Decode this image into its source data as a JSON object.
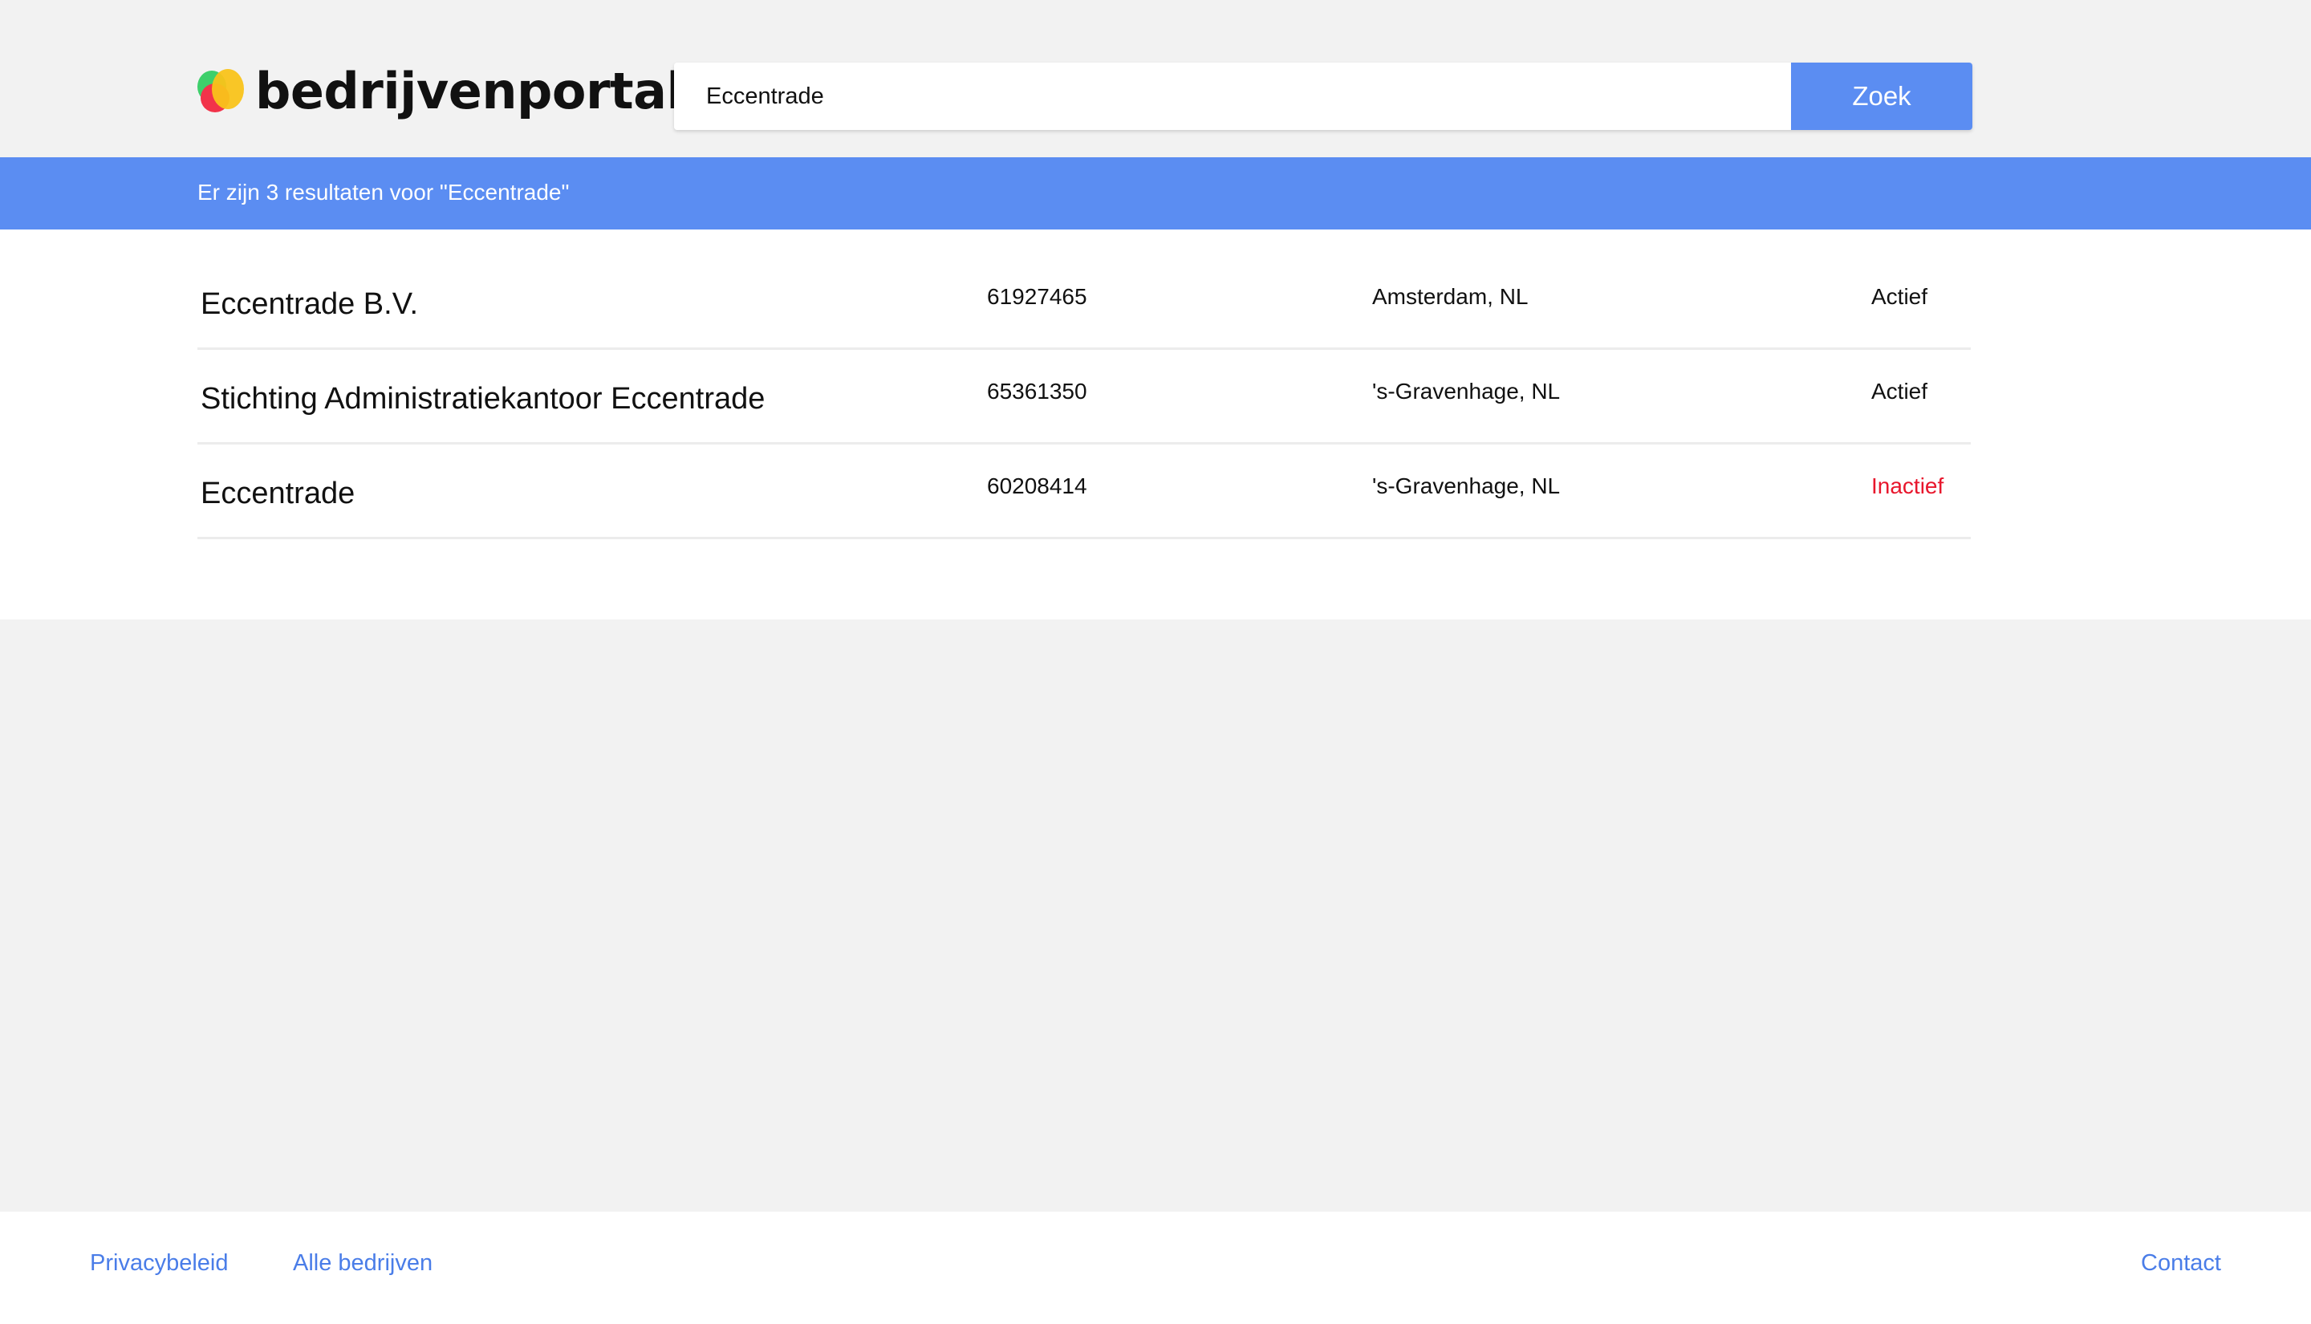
{
  "brand": {
    "name": "bedrijvenportal",
    "logo_icon": "colorful-blob-logo-icon",
    "colors": {
      "green": "#3ecf6b",
      "red": "#f2334a",
      "yellow": "#f9c31a"
    }
  },
  "search": {
    "value": "Eccentrade",
    "button_label": "Zoek"
  },
  "banner": {
    "text": "Er zijn 3 resultaten voor \"Eccentrade\""
  },
  "results": [
    {
      "name": "Eccentrade B.V.",
      "kvk": "61927465",
      "location": "Amsterdam, NL",
      "status": "Actief"
    },
    {
      "name": "Stichting Administratiekantoor Eccentrade",
      "kvk": "65361350",
      "location": "'s-Gravenhage, NL",
      "status": "Actief"
    },
    {
      "name": "Eccentrade",
      "kvk": "60208414",
      "location": "'s-Gravenhage, NL",
      "status": "Inactief"
    }
  ],
  "footer": {
    "privacy": "Privacybeleid",
    "all_companies": "Alle bedrijven",
    "contact": "Contact"
  },
  "colors": {
    "accent": "#5b8df2",
    "link": "#4a7de8",
    "inactive": "#e8162c",
    "background": "#f2f2f2"
  }
}
